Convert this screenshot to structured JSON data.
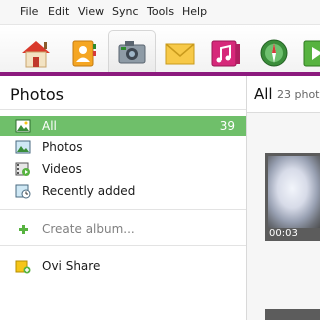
{
  "menu": {
    "file": "File",
    "edit": "Edit",
    "view": "View",
    "sync": "Sync",
    "tools": "Tools",
    "help": "Help"
  },
  "toolbar": {
    "icons": [
      "home-icon",
      "contacts-icon",
      "photos-icon",
      "messages-icon",
      "music-icon",
      "maps-icon",
      "video-icon"
    ],
    "selected": "photos-icon",
    "accent_color": "#8c1a7e"
  },
  "sidebar": {
    "title": "Photos",
    "items": [
      {
        "label": "All",
        "count": "39",
        "icon": "all-photos-icon",
        "selected": true
      },
      {
        "label": "Photos",
        "icon": "photos-icon"
      },
      {
        "label": "Videos",
        "icon": "videos-icon"
      },
      {
        "label": "Recently added",
        "icon": "recently-added-icon"
      }
    ],
    "create_album": {
      "label": "Create album...",
      "icon": "plus-icon"
    },
    "share": {
      "label": "Ovi Share",
      "icon": "ovi-share-icon"
    },
    "selected_color": "#6fbf6a"
  },
  "content": {
    "title": "All",
    "count_text": "23 phot",
    "thumbnails": [
      {
        "duration": "00:03"
      }
    ]
  }
}
